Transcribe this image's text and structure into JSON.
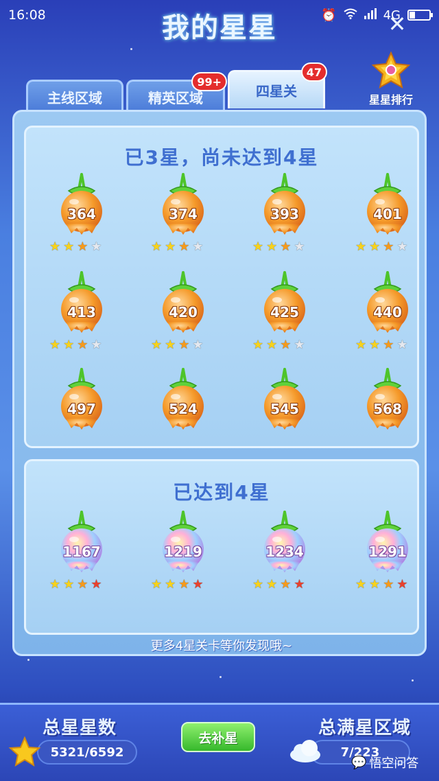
{
  "status_bar": {
    "time": "16:08",
    "network": "4G"
  },
  "title": "我的星星",
  "close_glyph": "✕",
  "tabs": [
    {
      "label": "主线区域",
      "badge": ""
    },
    {
      "label": "精英区域",
      "badge": "99+"
    },
    {
      "label": "四星关",
      "badge": "47",
      "active": true
    }
  ],
  "ranking_label": "星星排行",
  "sections": {
    "three_star": {
      "title": "已3星，尚未达到4星",
      "levels": [
        {
          "num": "364",
          "stars": 3,
          "max_stars": 4
        },
        {
          "num": "374",
          "stars": 3,
          "max_stars": 4
        },
        {
          "num": "393",
          "stars": 3,
          "max_stars": 4
        },
        {
          "num": "401",
          "stars": 3,
          "max_stars": 4
        },
        {
          "num": "413",
          "stars": 3,
          "max_stars": 4
        },
        {
          "num": "420",
          "stars": 3,
          "max_stars": 4
        },
        {
          "num": "425",
          "stars": 3,
          "max_stars": 4
        },
        {
          "num": "440",
          "stars": 3,
          "max_stars": 4
        },
        {
          "num": "497",
          "stars": 3,
          "max_stars": 4
        },
        {
          "num": "524",
          "stars": 3,
          "max_stars": 4
        },
        {
          "num": "545",
          "stars": 3,
          "max_stars": 4
        },
        {
          "num": "568",
          "stars": 3,
          "max_stars": 4
        }
      ]
    },
    "four_star": {
      "title": "已达到4星",
      "levels": [
        {
          "num": "1167",
          "stars": 4,
          "max_stars": 4
        },
        {
          "num": "1219",
          "stars": 4,
          "max_stars": 4
        },
        {
          "num": "1234",
          "stars": 4,
          "max_stars": 4
        },
        {
          "num": "1291",
          "stars": 4,
          "max_stars": 4
        }
      ]
    }
  },
  "more_text": "更多4星关卡等你发现哦~",
  "bottom": {
    "total_stars_label": "总星星数",
    "total_stars_value": "5321/6592",
    "replenish_button": "去补星",
    "full_star_label": "总满星区域",
    "full_star_value": "7/223"
  },
  "watermark": "悟空问答",
  "colors": {
    "star_yellow": "#f7d21c",
    "star_orange": "#f59a1c",
    "star_red": "#e8412d",
    "star_empty": "#e4e8ef",
    "badge_red": "#e42d2d"
  }
}
